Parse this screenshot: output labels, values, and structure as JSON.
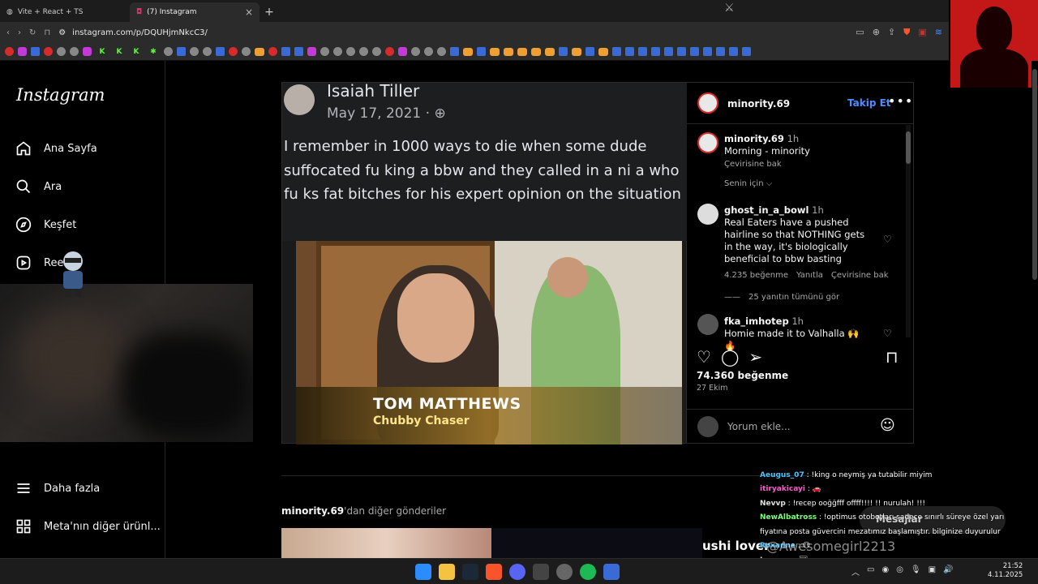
{
  "browser": {
    "tabs": [
      {
        "title": "Vite + React + TS",
        "active": false
      },
      {
        "title": "(7) Instagram",
        "active": true
      }
    ],
    "url": "instagram.com/p/DQUHjmNkcC3/",
    "new_tab": "+",
    "close": "×"
  },
  "sidebar": {
    "logo": "Instagram",
    "items": [
      {
        "label": "Ana Sayfa",
        "icon": "home-icon"
      },
      {
        "label": "Ara",
        "icon": "search-icon"
      },
      {
        "label": "Keşfet",
        "icon": "compass-icon"
      },
      {
        "label": "Reels",
        "icon": "reels-icon"
      }
    ],
    "bottom": [
      {
        "label": "Daha fazla",
        "icon": "menu-icon"
      },
      {
        "label": "Meta'nın diğer ürünl...",
        "icon": "apps-icon"
      }
    ]
  },
  "post": {
    "fb_name": "Isaiah Tiller",
    "fb_date": "May 17, 2021 · ",
    "fb_text": "I remember in 1000 ways to die when some dude suffocated fu king a bbw and they called in a ni  a who fu ks fat bitches for his expert opinion on the situation",
    "caption_line1": "TOM MATTHEWS",
    "caption_line2": "Chubby Chaser"
  },
  "panel": {
    "author": "minority.69",
    "follow": "Takip Et",
    "more": "•••",
    "caption": {
      "user": "minority.69",
      "time": "1h",
      "text": "Morning - minority",
      "translate": "Çevirisine bak"
    },
    "sort": "Senin için ⌵",
    "comments": [
      {
        "user": "ghost_in_a_bowl",
        "time": "1h",
        "text": "Real Eaters have a pushed hairline so that NOTHING gets in the way, it's biologically beneficial to bbw basting",
        "likes": "4.235 beğenme",
        "reply": "Yanıtla",
        "translate": "Çevirisine bak",
        "replies": "25 yanıtın tümünü gör"
      },
      {
        "user": "fka_imhotep",
        "time": "1h",
        "text": "Homie made it to Valhalla 🙌 🔥"
      }
    ],
    "likes": "74.360 beğenme",
    "date": "27 Ekim",
    "add_comment": "Yorum ekle..."
  },
  "more_posts": {
    "user": "minority.69",
    "suffix": "'dan diğer gönderiler"
  },
  "overlay": {
    "sushi": "ushi lover",
    "watermark": "@Awesomegirl2213",
    "messages": "Mesajlar",
    "chat": [
      {
        "name": "Aeugus_07",
        "text": " : !king o neymiş ya tutabilir miyim",
        "cls": "n1"
      },
      {
        "name": "itiryakicayi",
        "text": " : 🚗",
        "cls": "n2"
      },
      {
        "name": "Nevvp",
        "text": " : !recep ooğğfff offff!!!! !! nurulah! !!!",
        "cls": "n4"
      },
      {
        "name": "NewAlbatross",
        "text": " : !optimus otobotları sadece sınırlı süreye özel yarı",
        "cls": "n3"
      },
      {
        "name": "",
        "text": "fiyatına posta güvercini mezatımız başlamıştır. bilginize duyurulur",
        "cls": "n4"
      },
      {
        "name": "Roxanne",
        "text": " : 😶",
        "cls": "n1"
      },
      {
        "name": "Largvar",
        "text": " : 🖼",
        "cls": "n4"
      }
    ]
  },
  "taskbar": {
    "time": "21:52",
    "date": "4.11.2025"
  }
}
